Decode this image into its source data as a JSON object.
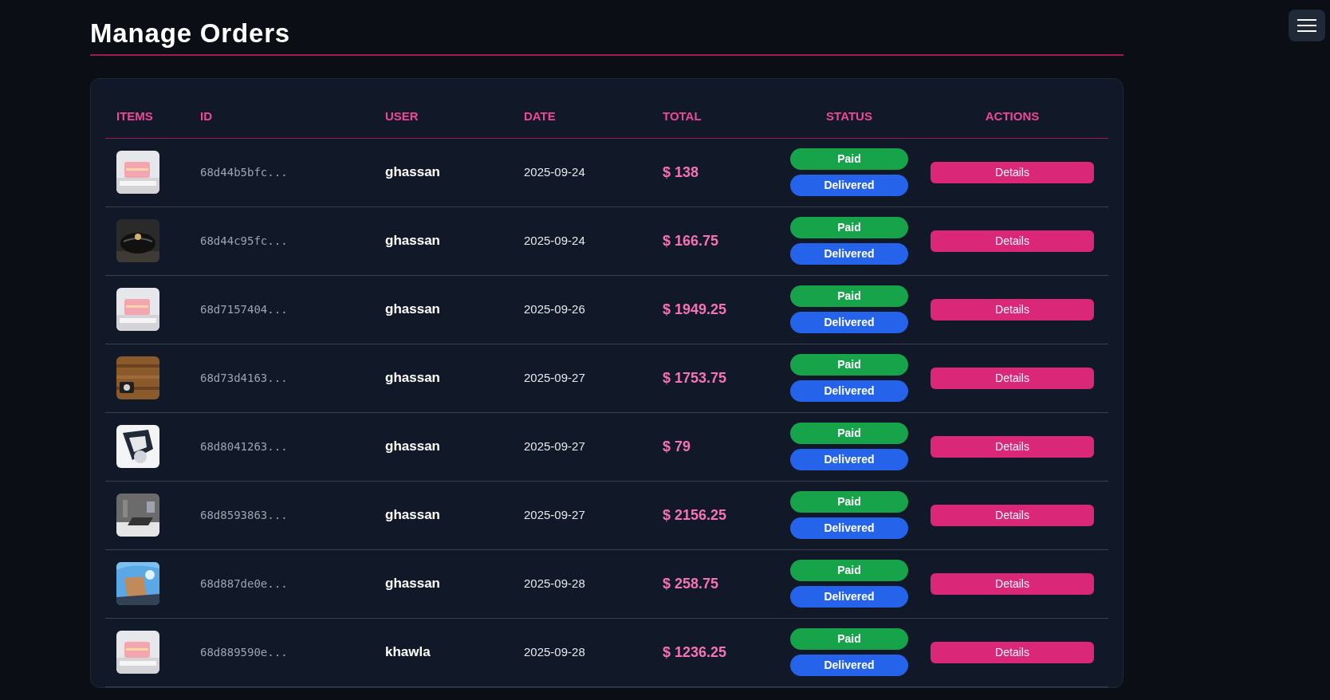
{
  "title": "Manage Orders",
  "table": {
    "columns": [
      "ITEMS",
      "ID",
      "USER",
      "DATE",
      "TOTAL",
      "STATUS",
      "ACTIONS"
    ],
    "rows": [
      {
        "id": "68d44b5bfc...",
        "user": "ghassan",
        "date": "2025-09-24",
        "total": "$ 138",
        "payment": "Paid",
        "delivery": "Delivered",
        "action": "Details"
      },
      {
        "id": "68d44c95fc...",
        "user": "ghassan",
        "date": "2025-09-24",
        "total": "$ 166.75",
        "payment": "Paid",
        "delivery": "Delivered",
        "action": "Details"
      },
      {
        "id": "68d7157404...",
        "user": "ghassan",
        "date": "2025-09-26",
        "total": "$ 1949.25",
        "payment": "Paid",
        "delivery": "Delivered",
        "action": "Details"
      },
      {
        "id": "68d73d4163...",
        "user": "ghassan",
        "date": "2025-09-27",
        "total": "$ 1753.75",
        "payment": "Paid",
        "delivery": "Delivered",
        "action": "Details"
      },
      {
        "id": "68d8041263...",
        "user": "ghassan",
        "date": "2025-09-27",
        "total": "$ 79",
        "payment": "Paid",
        "delivery": "Delivered",
        "action": "Details"
      },
      {
        "id": "68d8593863...",
        "user": "ghassan",
        "date": "2025-09-27",
        "total": "$ 2156.25",
        "payment": "Paid",
        "delivery": "Delivered",
        "action": "Details"
      },
      {
        "id": "68d887de0e...",
        "user": "ghassan",
        "date": "2025-09-28",
        "total": "$ 258.75",
        "payment": "Paid",
        "delivery": "Delivered",
        "action": "Details"
      },
      {
        "id": "68d889590e...",
        "user": "khawla",
        "date": "2025-09-28",
        "total": "$ 1236.25",
        "payment": "Paid",
        "delivery": "Delivered",
        "action": "Details"
      }
    ]
  }
}
